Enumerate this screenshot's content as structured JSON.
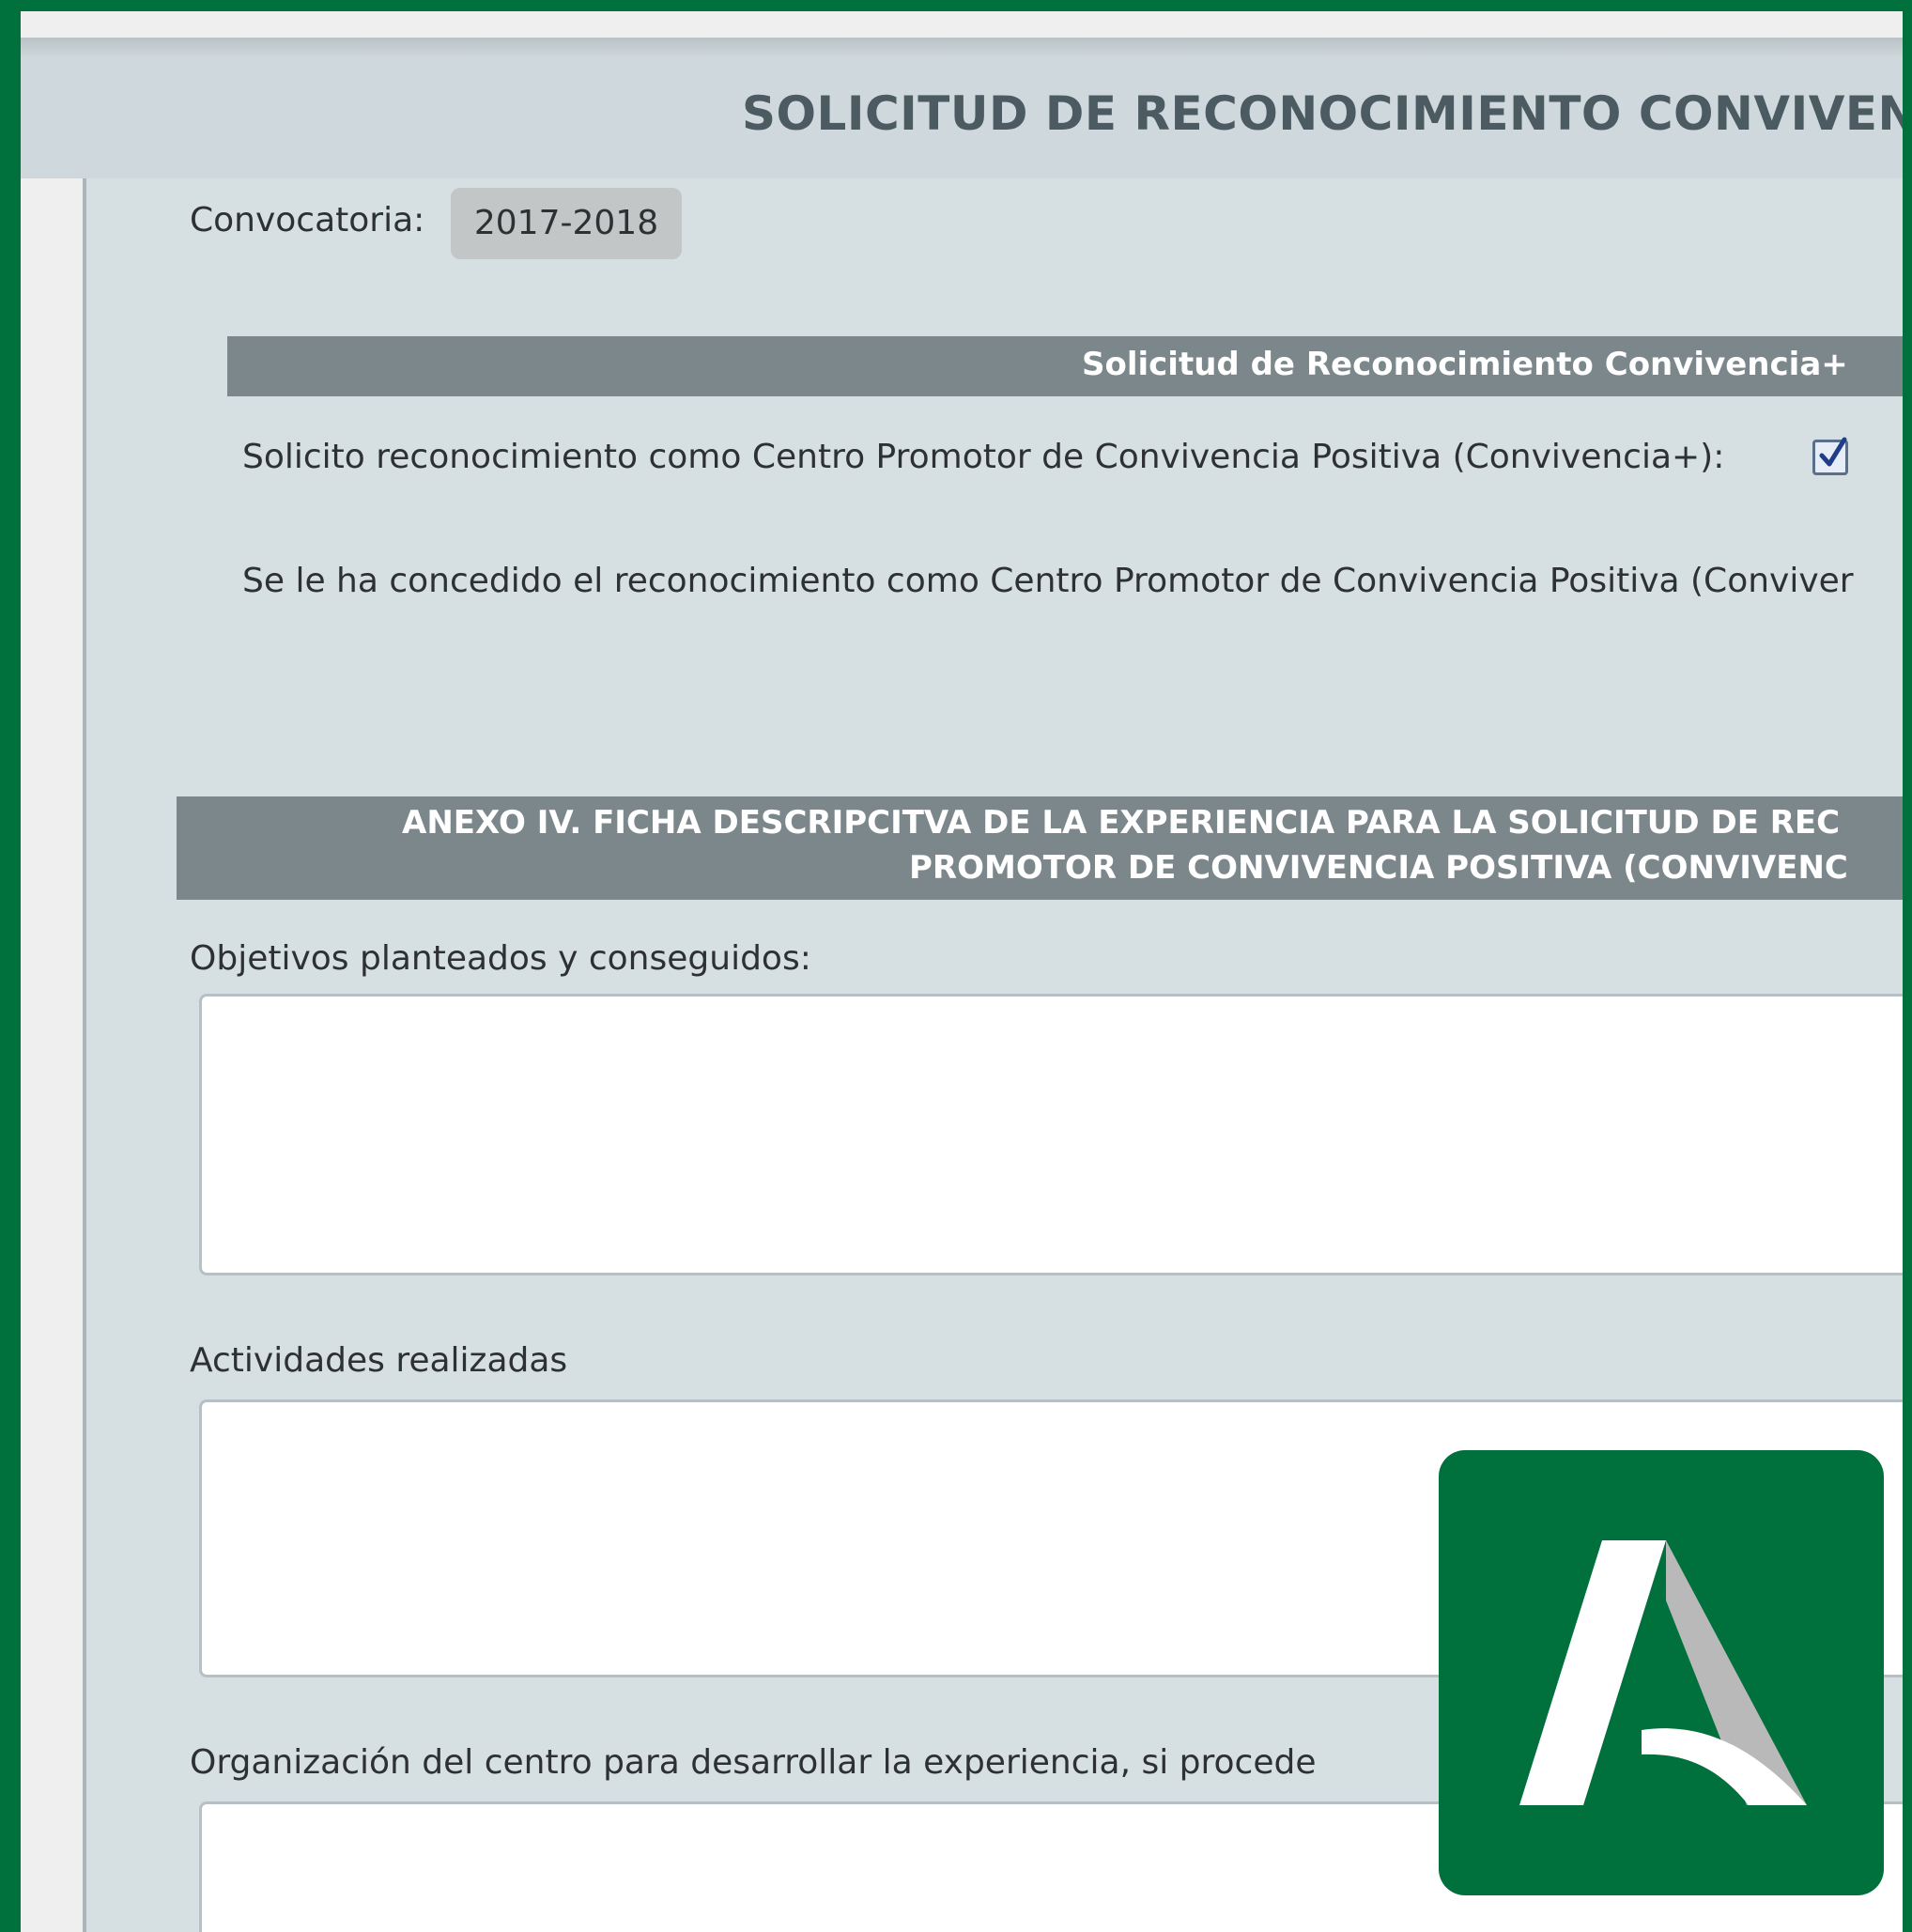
{
  "page": {
    "title": "SOLICITUD DE RECONOCIMIENTO CONVIVEN"
  },
  "convocatoria": {
    "label": "Convocatoria:",
    "value": "2017-2018"
  },
  "section_reconocimiento": {
    "heading": "Solicitud de Reconocimiento Convivencia+",
    "solicito_label": "Solicito reconocimiento como Centro Promotor de Convivencia Positiva (Convivencia+):",
    "solicito_checked": true,
    "concedido_label": "Se le ha concedido el reconocimiento como Centro Promotor de Convivencia Positiva (Conviver"
  },
  "section_anexo": {
    "heading_line1": "ANEXO IV. FICHA DESCRIPCITVA DE LA EXPERIENCIA PARA LA SOLICITUD DE REC",
    "heading_line2": "PROMOTOR DE CONVIVENCIA POSITIVA (CONVIVENC"
  },
  "fields": [
    {
      "label": "Objetivos planteados y conseguidos:",
      "value": ""
    },
    {
      "label": "Actividades realizadas",
      "value": ""
    },
    {
      "label": "Organización del centro para desarrollar la experiencia, si procede",
      "value": ""
    }
  ],
  "colors": {
    "brand_green": "#00703c",
    "section_bar": "#7c878c",
    "content_bg": "#d6dfe2",
    "title_text": "#4c5a62"
  },
  "icons": {
    "logo": "junta-andalucia-logo-icon",
    "checkbox": "checkbox-checked-icon"
  }
}
